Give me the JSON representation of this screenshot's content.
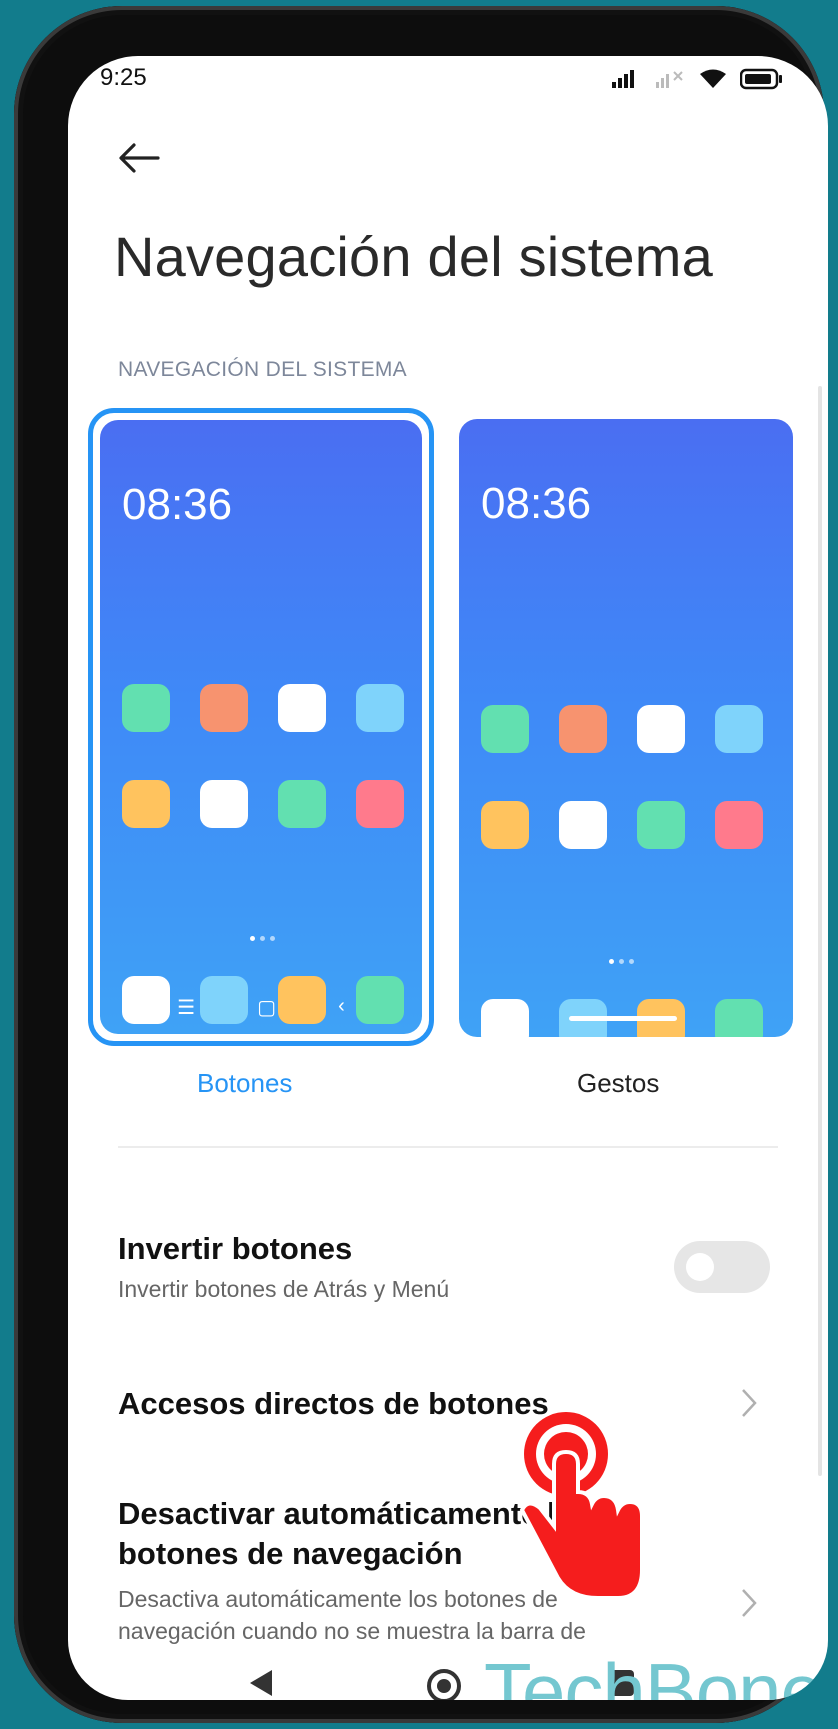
{
  "status": {
    "time": "9:25"
  },
  "header": {
    "title": "Navegación del sistema"
  },
  "section": {
    "label": "NAVEGACIÓN DEL SISTEMA"
  },
  "options": [
    {
      "label": "Botones",
      "clock": "08:36",
      "selected": true
    },
    {
      "label": "Gestos",
      "clock": "08:36",
      "selected": false
    }
  ],
  "settings": {
    "invert": {
      "title": "Invertir botones",
      "subtitle": "Invertir botones de Atrás y Menú",
      "enabled": false
    },
    "shortcuts": {
      "title": "Accesos directos de botones"
    },
    "autohide": {
      "title_line1": "Desactivar automáticamente los",
      "title_line2": "botones de navegación",
      "subtitle_line1": "Desactiva automáticamente los botones de",
      "subtitle_line2": "navegación cuando no se muestra la barra de"
    }
  },
  "watermark": {
    "text": "TechBone"
  },
  "colors": {
    "accent": "#2694f5",
    "screen_gradient": [
      "#4a6ef2",
      "#3fa2f6"
    ],
    "app_colors": [
      "#62e0b0",
      "#f7936f",
      "#ffffff",
      "#7fd3fb",
      "#ffc35e",
      "#ff7a8c"
    ],
    "hand": "#f51d1d"
  }
}
